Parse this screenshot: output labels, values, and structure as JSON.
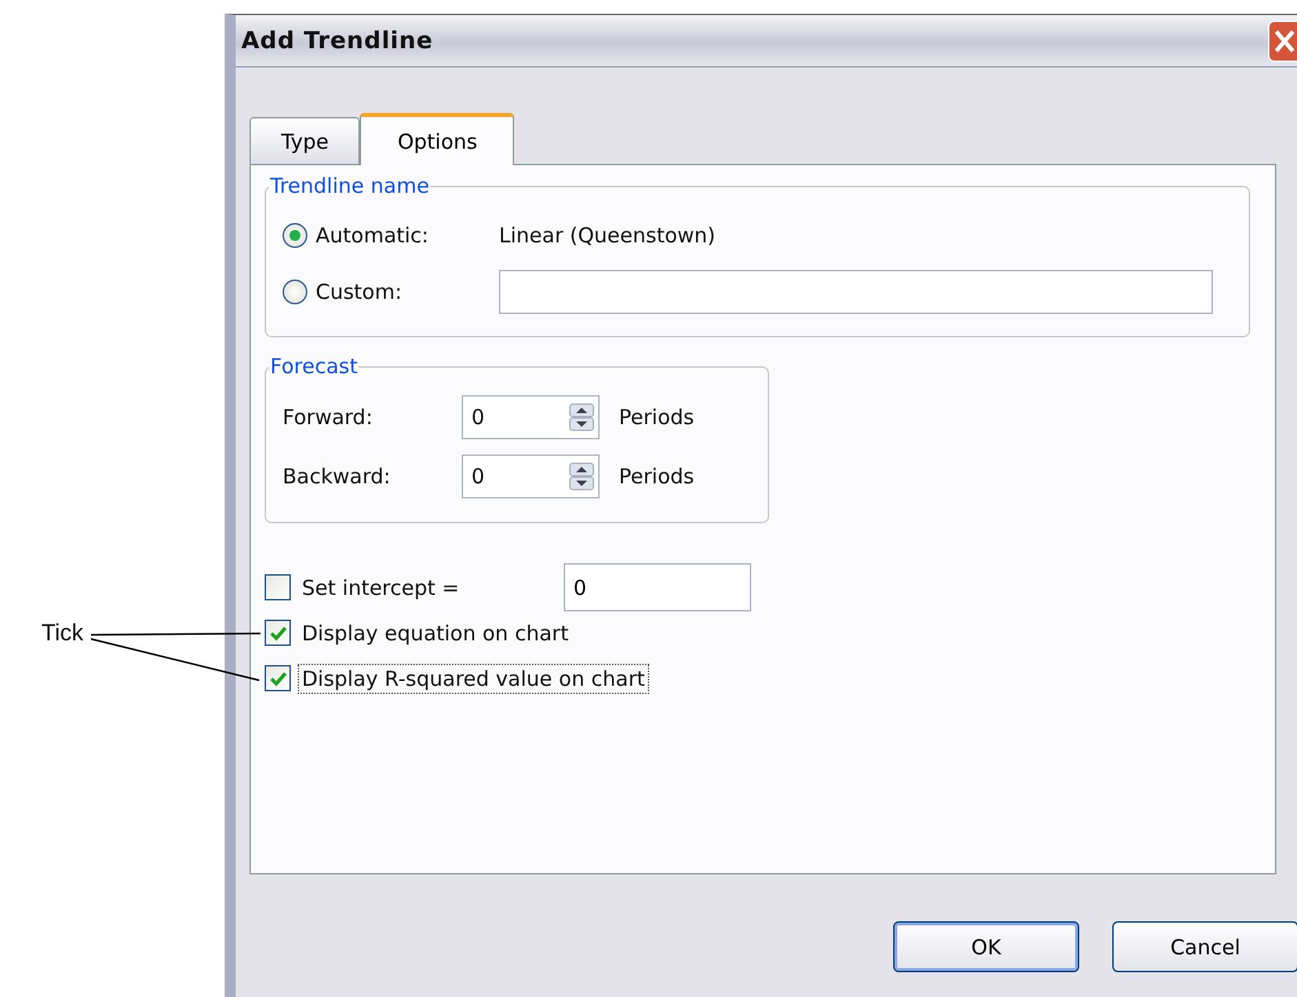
{
  "window": {
    "title": "Add Trendline"
  },
  "tabs": [
    {
      "label": "Type",
      "selected": false
    },
    {
      "label": "Options",
      "selected": true
    }
  ],
  "trendline_name": {
    "title": "Trendline name",
    "options": [
      {
        "label": "Automatic:",
        "selected": true,
        "kind": "text",
        "value": "Linear (Queenstown)"
      },
      {
        "label": "Custom:",
        "selected": false,
        "kind": "field"
      }
    ]
  },
  "forecast": {
    "title": "Forecast",
    "rows": [
      {
        "label": "Forward:",
        "value": "0",
        "unit": "Periods"
      },
      {
        "label": "Backward:",
        "value": "0",
        "unit": "Periods"
      }
    ]
  },
  "options": [
    {
      "label": "Set intercept =",
      "checked": false,
      "focused": false,
      "value": "0"
    },
    {
      "label": "Display equation on chart",
      "checked": true,
      "focused": false
    },
    {
      "label": "Display R-squared value on chart",
      "checked": true,
      "focused": true
    }
  ],
  "buttons": [
    {
      "label": "OK",
      "default": true
    },
    {
      "label": "Cancel",
      "default": false
    }
  ],
  "annotation": {
    "label": "Tick"
  }
}
